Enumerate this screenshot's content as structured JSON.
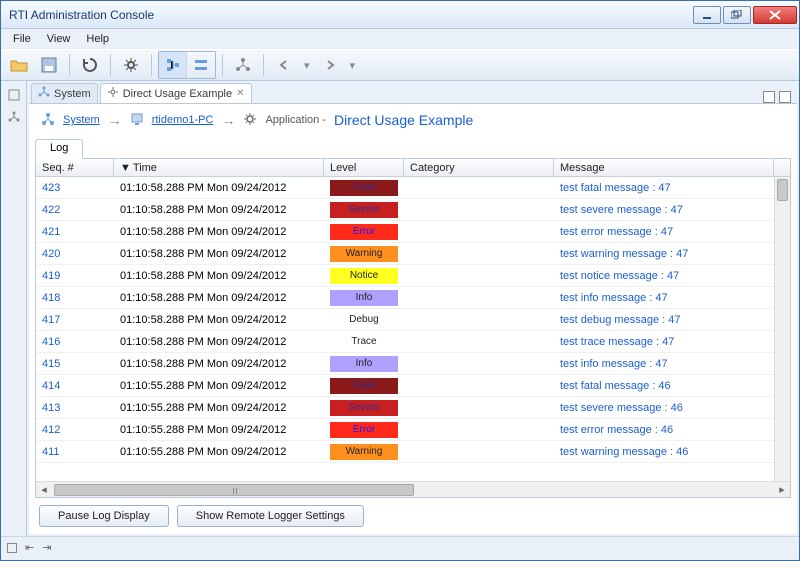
{
  "window": {
    "title": "RTI Administration Console"
  },
  "menu": {
    "file": "File",
    "view": "View",
    "help": "Help"
  },
  "tabs": {
    "system": "System",
    "direct_usage": "Direct Usage Example"
  },
  "breadcrumb": {
    "system": "System",
    "host": "rtidemo1-PC",
    "app_label": "Application -",
    "app_name": "Direct Usage Example"
  },
  "log": {
    "tab": "Log",
    "columns": {
      "seq": "Seq. #",
      "time": "Time",
      "level": "Level",
      "category": "Category",
      "message": "Message"
    },
    "rows": [
      {
        "seq": "423",
        "time": "01:10:58.288 PM Mon 09/24/2012",
        "level": "Fatal",
        "level_cls": "fatal",
        "msg": "test fatal message : 47"
      },
      {
        "seq": "422",
        "time": "01:10:58.288 PM Mon 09/24/2012",
        "level": "Severe",
        "level_cls": "severe",
        "msg": "test severe message : 47"
      },
      {
        "seq": "421",
        "time": "01:10:58.288 PM Mon 09/24/2012",
        "level": "Error",
        "level_cls": "error",
        "msg": "test error message : 47"
      },
      {
        "seq": "420",
        "time": "01:10:58.288 PM Mon 09/24/2012",
        "level": "Warning",
        "level_cls": "warning",
        "msg": "test warning message : 47"
      },
      {
        "seq": "419",
        "time": "01:10:58.288 PM Mon 09/24/2012",
        "level": "Notice",
        "level_cls": "notice",
        "msg": "test notice message : 47"
      },
      {
        "seq": "418",
        "time": "01:10:58.288 PM Mon 09/24/2012",
        "level": "Info",
        "level_cls": "info",
        "msg": "test info message : 47"
      },
      {
        "seq": "417",
        "time": "01:10:58.288 PM Mon 09/24/2012",
        "level": "Debug",
        "level_cls": "debug",
        "msg": "test debug message : 47"
      },
      {
        "seq": "416",
        "time": "01:10:58.288 PM Mon 09/24/2012",
        "level": "Trace",
        "level_cls": "trace",
        "msg": "test trace message : 47"
      },
      {
        "seq": "415",
        "time": "01:10:58.288 PM Mon 09/24/2012",
        "level": "Info",
        "level_cls": "info",
        "msg": "test info message : 47"
      },
      {
        "seq": "414",
        "time": "01:10:55.288 PM Mon 09/24/2012",
        "level": "Fatal",
        "level_cls": "fatal",
        "msg": "test fatal message : 46"
      },
      {
        "seq": "413",
        "time": "01:10:55.288 PM Mon 09/24/2012",
        "level": "Severe",
        "level_cls": "severe",
        "msg": "test severe message : 46"
      },
      {
        "seq": "412",
        "time": "01:10:55.288 PM Mon 09/24/2012",
        "level": "Error",
        "level_cls": "error",
        "msg": "test error message : 46"
      },
      {
        "seq": "411",
        "time": "01:10:55.288 PM Mon 09/24/2012",
        "level": "Warning",
        "level_cls": "warning",
        "msg": "test warning message : 46"
      }
    ]
  },
  "buttons": {
    "pause": "Pause Log Display",
    "show_settings": "Show Remote Logger Settings"
  }
}
